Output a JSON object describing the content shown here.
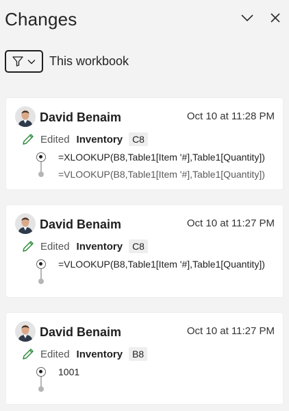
{
  "header": {
    "title": "Changes",
    "collapse_icon": "chevron-down-icon",
    "close_icon": "close-icon"
  },
  "filter": {
    "icon": "filter-icon",
    "dropdown_icon": "chevron-down-icon",
    "scope": "This workbook"
  },
  "colors": {
    "panel_bg": "#f3f3f3",
    "card_bg": "#ffffff",
    "edit_icon": "#2e8b3d"
  },
  "changes": [
    {
      "author": "David Benaim",
      "time": "Oct 10 at 11:28 PM",
      "action": "Edited",
      "sheet": "Inventory",
      "cell": "C8",
      "new_value": "=XLOOKUP(B8,Table1[Item '#],Table1[Quantity])",
      "old_value": "=VLOOKUP(B8,Table1[Item '#],Table1[Quantity])"
    },
    {
      "author": "David Benaim",
      "time": "Oct 10 at 11:27 PM",
      "action": "Edited",
      "sheet": "Inventory",
      "cell": "C8",
      "new_value": "=VLOOKUP(B8,Table1[Item '#],Table1[Quantity])"
    },
    {
      "author": "David Benaim",
      "time": "Oct 10 at 11:27 PM",
      "action": "Edited",
      "sheet": "Inventory",
      "cell": "B8",
      "new_value": "1001"
    }
  ]
}
